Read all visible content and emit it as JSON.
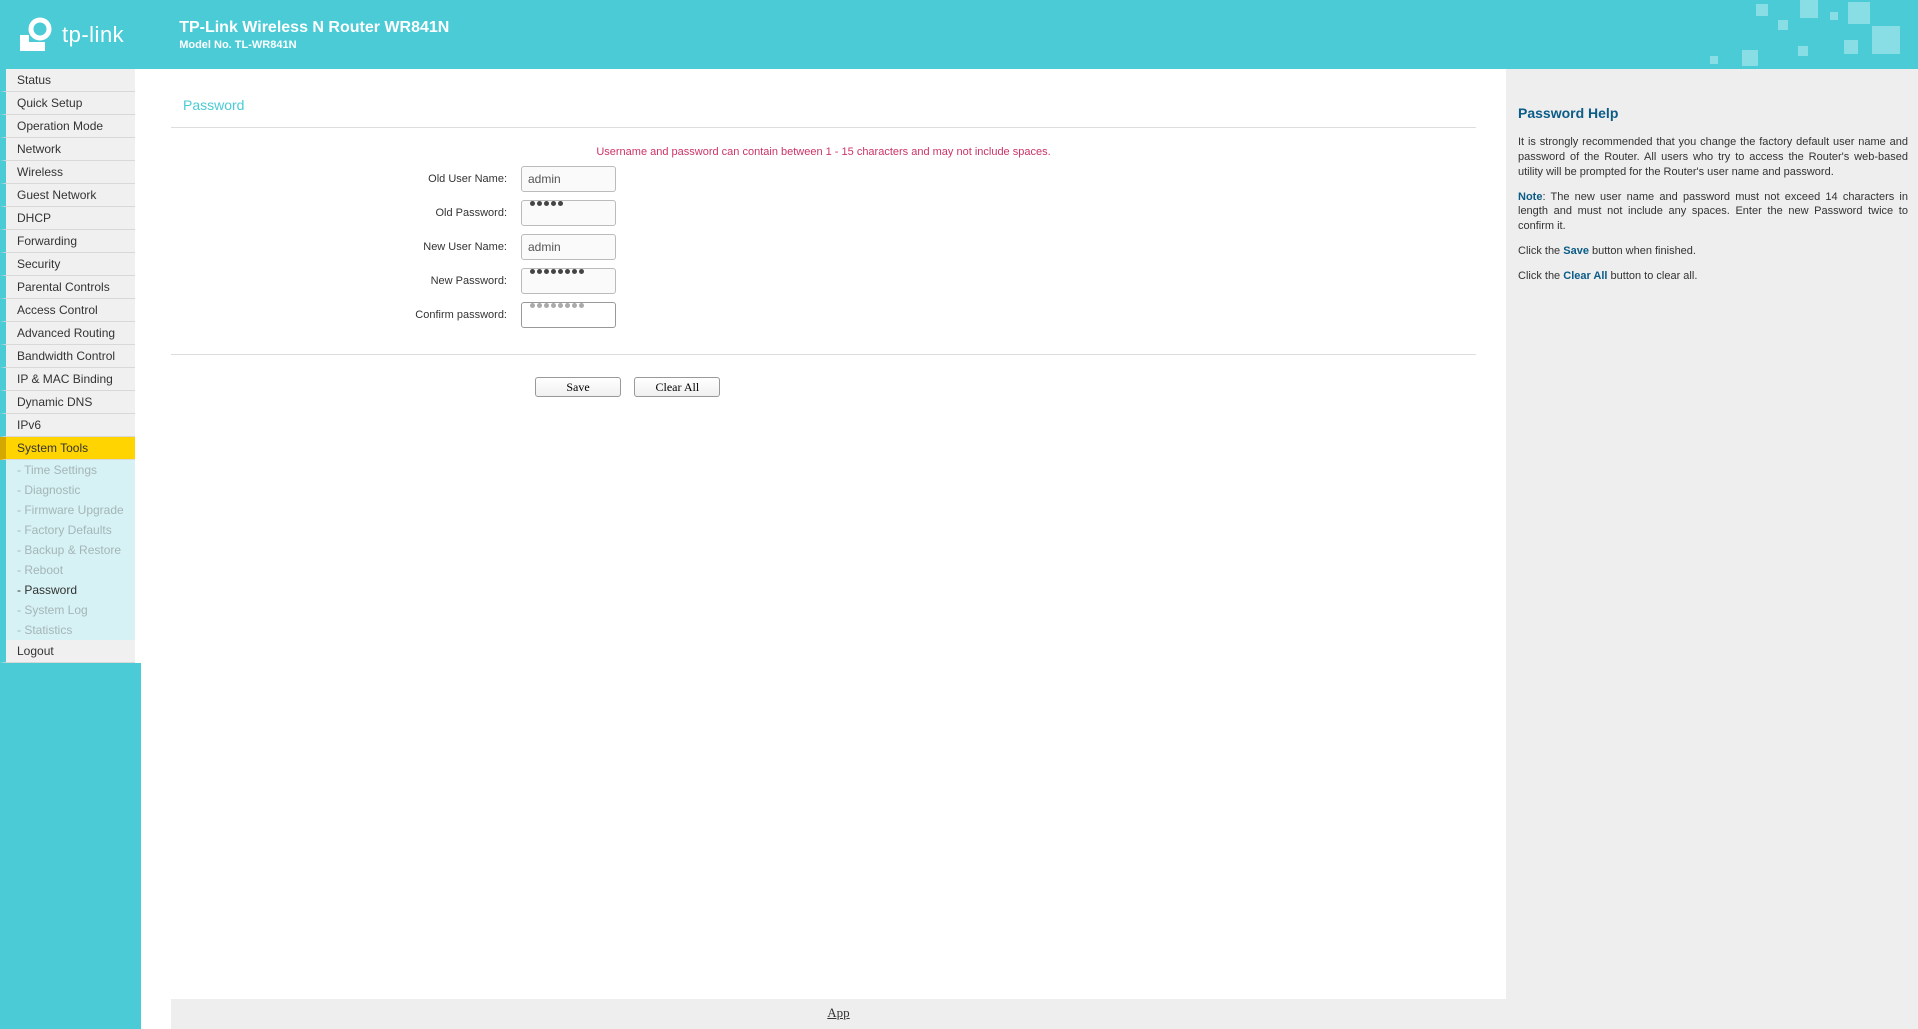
{
  "header": {
    "brand": "tp-link",
    "title": "TP-Link Wireless N Router WR841N",
    "model": "Model No. TL-WR841N"
  },
  "nav": {
    "items": [
      "Status",
      "Quick Setup",
      "Operation Mode",
      "Network",
      "Wireless",
      "Guest Network",
      "DHCP",
      "Forwarding",
      "Security",
      "Parental Controls",
      "Access Control",
      "Advanced Routing",
      "Bandwidth Control",
      "IP & MAC Binding",
      "Dynamic DNS",
      "IPv6",
      "System Tools",
      "Logout"
    ],
    "active": "System Tools",
    "sub": [
      "- Time Settings",
      "- Diagnostic",
      "- Firmware Upgrade",
      "- Factory Defaults",
      "- Backup & Restore",
      "- Reboot",
      "- Password",
      "- System Log",
      "- Statistics"
    ],
    "sub_current": "- Password"
  },
  "page": {
    "title": "Password",
    "hint": "Username and password can contain between 1 - 15 characters and may not include spaces.",
    "labels": {
      "old_user": "Old User Name:",
      "old_pass": "Old Password:",
      "new_user": "New User Name:",
      "new_pass": "New Password:",
      "confirm": "Confirm password:"
    },
    "values": {
      "old_user": "admin",
      "old_pass_len": 5,
      "new_user": "admin",
      "new_pass_len": 8,
      "confirm_len": 8
    },
    "buttons": {
      "save": "Save",
      "clear": "Clear All"
    }
  },
  "help": {
    "title": "Password Help",
    "p1": "It is strongly recommended that you change the factory default user name and password of the Router. All users who try to access the Router's web-based utility will be prompted for the Router's user name and password.",
    "note_label": "Note",
    "p2": ": The new user name and password must not exceed 14 characters in length and must not include any spaces. Enter the new Password twice to confirm it.",
    "p3a": "Click the ",
    "p3b": "Save",
    "p3c": " button when finished.",
    "p4a": "Click the ",
    "p4b": "Clear All",
    "p4c": " button to clear all."
  },
  "footer": {
    "app": "App"
  }
}
